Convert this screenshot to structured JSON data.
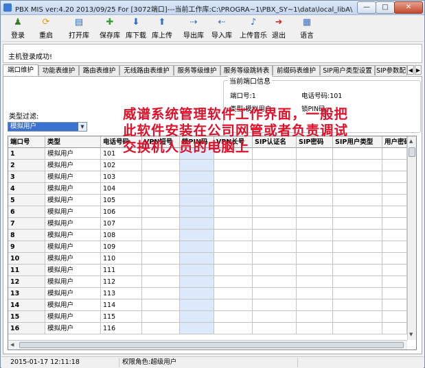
{
  "window": {
    "title": "PBX MIS ver:4.20  2013/09/25 For [3072端口]---当前工作库:C:\\PROGRA~1\\PBX_SY~1\\data\\local_libA\\",
    "min": "—",
    "max": "□",
    "close": "✕"
  },
  "toolbar": [
    {
      "label": "登录",
      "icon": "login-icon",
      "glyph": "♟",
      "color": "#3c7a2c"
    },
    {
      "label": "重启",
      "icon": "restart-icon",
      "glyph": "⟳",
      "color": "#d8a010"
    },
    {
      "label": "打开库",
      "icon": "open-db-icon",
      "glyph": "▤",
      "color": "#2f6fbf"
    },
    {
      "label": "保存库",
      "icon": "save-db-icon",
      "glyph": "✚",
      "color": "#3a9b3a"
    },
    {
      "label": "库下载",
      "icon": "db-download-icon",
      "glyph": "⬇",
      "color": "#2f6fbf"
    },
    {
      "label": "库上传",
      "icon": "db-upload-icon",
      "glyph": "⬆",
      "color": "#2f6fbf"
    },
    {
      "label": "导出库",
      "icon": "export-db-icon",
      "glyph": "⇢",
      "color": "#2f6fbf"
    },
    {
      "label": "导入库",
      "icon": "import-db-icon",
      "glyph": "⇠",
      "color": "#2f6fbf"
    },
    {
      "label": "上传音乐",
      "icon": "upload-music-icon",
      "glyph": "♪",
      "color": "#2f6fbf"
    },
    {
      "label": "退出",
      "icon": "exit-icon",
      "glyph": "➜",
      "color": "#d03020"
    },
    {
      "label": "语言",
      "icon": "language-icon",
      "glyph": "▦",
      "color": "#3a6fbf"
    }
  ],
  "message": "主机登录成功!",
  "tabs": [
    {
      "label": "端口维护",
      "active": true
    },
    {
      "label": "功能表维护"
    },
    {
      "label": "路由表维护"
    },
    {
      "label": "无线路由表维护"
    },
    {
      "label": "服务等级维护"
    },
    {
      "label": "服务等级跳转表"
    },
    {
      "label": "前缀码表维护"
    },
    {
      "label": "SIP用户类型设置"
    },
    {
      "label": "SIP参数配"
    }
  ],
  "port_info": {
    "title": "当前端口信息",
    "port": "端口号:1",
    "phone": "电话号码:101",
    "type": "类型:模拟用户",
    "pin": "锁PIN码:"
  },
  "filter": {
    "label": "类型过滤:",
    "value": "模拟用户"
  },
  "grid": {
    "columns": [
      "端口号",
      "类型",
      "电话号码",
      "VPN短号",
      "锁PIN码",
      "VPN长号",
      "SIP认证名",
      "SIP密码",
      "SIP用户类型",
      "用户密码"
    ],
    "rows": [
      [
        "1",
        "模拟用户",
        "101"
      ],
      [
        "2",
        "模拟用户",
        "102"
      ],
      [
        "3",
        "模拟用户",
        "103"
      ],
      [
        "4",
        "模拟用户",
        "104"
      ],
      [
        "5",
        "模拟用户",
        "105"
      ],
      [
        "6",
        "模拟用户",
        "106"
      ],
      [
        "7",
        "模拟用户",
        "107"
      ],
      [
        "8",
        "模拟用户",
        "108"
      ],
      [
        "9",
        "模拟用户",
        "109"
      ],
      [
        "10",
        "模拟用户",
        "110"
      ],
      [
        "11",
        "模拟用户",
        "111"
      ],
      [
        "12",
        "模拟用户",
        "112"
      ],
      [
        "13",
        "模拟用户",
        "113"
      ],
      [
        "14",
        "模拟用户",
        "114"
      ],
      [
        "15",
        "模拟用户",
        "115"
      ],
      [
        "16",
        "模拟用户",
        "116"
      ]
    ]
  },
  "overlay_text": [
    "威谱系统管理软件工作界面，一般把",
    "此软件安装在公司网管或者负责调试",
    "交换机人员的电脑上"
  ],
  "status": {
    "datetime": "2015-01-17 12:11:18",
    "role": "权限角色:超级用户"
  }
}
